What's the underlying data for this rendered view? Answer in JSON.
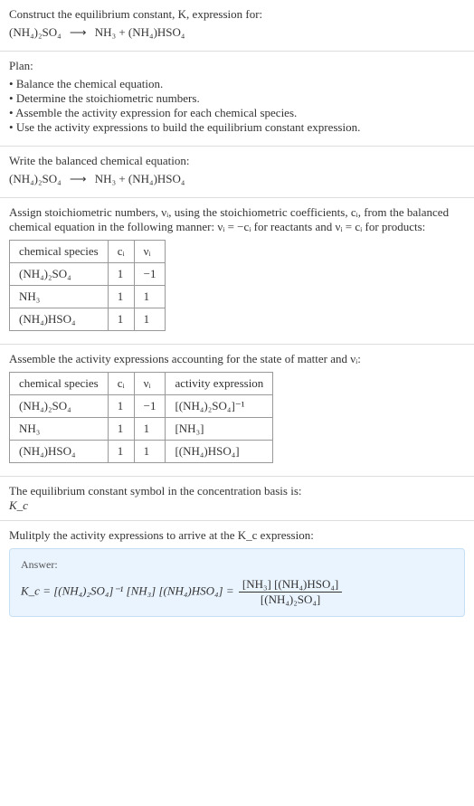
{
  "intro": {
    "line1": "Construct the equilibrium constant, K, expression for:",
    "reaction_left": "(NH₄)₂SO₄",
    "reaction_arrow": "⟶",
    "reaction_right": "NH₃ + (NH₄)HSO₄"
  },
  "plan": {
    "title": "Plan:",
    "items": [
      "Balance the chemical equation.",
      "Determine the stoichiometric numbers.",
      "Assemble the activity expression for each chemical species.",
      "Use the activity expressions to build the equilibrium constant expression."
    ]
  },
  "balanced": {
    "title": "Write the balanced chemical equation:",
    "left": "(NH₄)₂SO₄",
    "arrow": "⟶",
    "right": "NH₃ + (NH₄)HSO₄"
  },
  "stoich": {
    "intro": "Assign stoichiometric numbers, νᵢ, using the stoichiometric coefficients, cᵢ, from the balanced chemical equation in the following manner: νᵢ = −cᵢ for reactants and νᵢ = cᵢ for products:",
    "headers": {
      "species": "chemical species",
      "ci": "cᵢ",
      "vi": "νᵢ"
    },
    "rows": [
      {
        "species": "(NH₄)₂SO₄",
        "ci": "1",
        "vi": "−1"
      },
      {
        "species": "NH₃",
        "ci": "1",
        "vi": "1"
      },
      {
        "species": "(NH₄)HSO₄",
        "ci": "1",
        "vi": "1"
      }
    ]
  },
  "activity": {
    "intro": "Assemble the activity expressions accounting for the state of matter and νᵢ:",
    "headers": {
      "species": "chemical species",
      "ci": "cᵢ",
      "vi": "νᵢ",
      "expr": "activity expression"
    },
    "rows": [
      {
        "species": "(NH₄)₂SO₄",
        "ci": "1",
        "vi": "−1",
        "expr": "[(NH₄)₂SO₄]⁻¹"
      },
      {
        "species": "NH₃",
        "ci": "1",
        "vi": "1",
        "expr": "[NH₃]"
      },
      {
        "species": "(NH₄)HSO₄",
        "ci": "1",
        "vi": "1",
        "expr": "[(NH₄)HSO₄]"
      }
    ]
  },
  "symbol": {
    "line1": "The equilibrium constant symbol in the concentration basis is:",
    "line2": "K_c"
  },
  "multiply": {
    "text": "Mulitply the activity expressions to arrive at the K_c expression:"
  },
  "answer": {
    "label": "Answer:",
    "lhs": "K_c = [(NH₄)₂SO₄]⁻¹ [NH₃] [(NH₄)HSO₄] =",
    "frac_num": "[NH₃] [(NH₄)HSO₄]",
    "frac_den": "[(NH₄)₂SO₄]"
  },
  "chart_data": {
    "type": "table",
    "tables": [
      {
        "title": "stoichiometric numbers",
        "columns": [
          "chemical species",
          "c_i",
          "ν_i"
        ],
        "rows": [
          [
            "(NH4)2SO4",
            1,
            -1
          ],
          [
            "NH3",
            1,
            1
          ],
          [
            "(NH4)HSO4",
            1,
            1
          ]
        ]
      },
      {
        "title": "activity expressions",
        "columns": [
          "chemical species",
          "c_i",
          "ν_i",
          "activity expression"
        ],
        "rows": [
          [
            "(NH4)2SO4",
            1,
            -1,
            "[(NH4)2SO4]^-1"
          ],
          [
            "NH3",
            1,
            1,
            "[NH3]"
          ],
          [
            "(NH4)HSO4",
            1,
            1,
            "[(NH4)HSO4]"
          ]
        ]
      }
    ],
    "reaction": "(NH4)2SO4 -> NH3 + (NH4)HSO4",
    "Kc_expression": "Kc = [NH3][(NH4)HSO4] / [(NH4)2SO4]"
  }
}
